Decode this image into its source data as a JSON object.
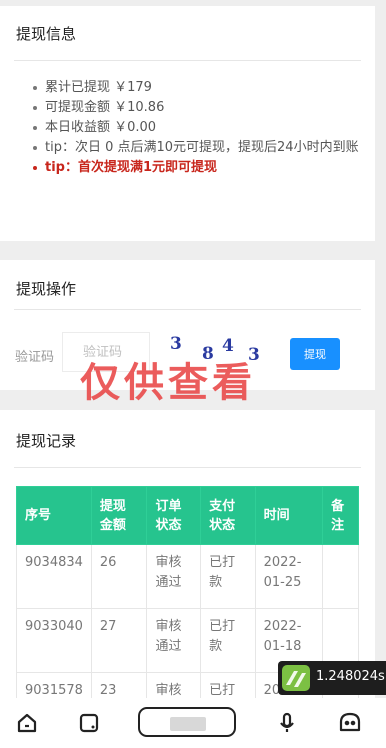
{
  "info": {
    "title": "提现信息",
    "items": [
      "累计已提现 ￥179",
      "可提现金额 ￥10.86",
      "本日收益额 ￥0.00",
      "tip：次日 0 点后满10元可提现，提现后24小时内到账",
      "tip：首次提现满1元即可提现"
    ]
  },
  "action": {
    "title": "提现操作",
    "captcha_label": "验证码",
    "captcha_placeholder": "验证码",
    "captcha_chars": [
      "3",
      "8",
      "4",
      "3"
    ],
    "submit_label": "提现"
  },
  "watermark": "仅供查看",
  "records": {
    "title": "提现记录",
    "columns": [
      "序号",
      "提现金额",
      "订单状态",
      "支付状态",
      "时间",
      "备注"
    ],
    "rows": [
      [
        "9034834",
        "26",
        "审核通过",
        "已打款",
        "2022-01-25",
        ""
      ],
      [
        "9033040",
        "27",
        "审核通过",
        "已打款",
        "2022-01-18",
        ""
      ],
      [
        "9031578",
        "23",
        "审核",
        "已打",
        "20",
        ""
      ]
    ]
  },
  "speed_badge": "1.248024s",
  "colors": {
    "table_header": "#26c48e",
    "button": "#1890ff",
    "tip_red": "#c8261c",
    "watermark": "#e84646"
  },
  "nav_icons": [
    "home-icon",
    "square-corner-icon",
    "pill-button",
    "microphone-icon",
    "assistant-face-icon"
  ]
}
